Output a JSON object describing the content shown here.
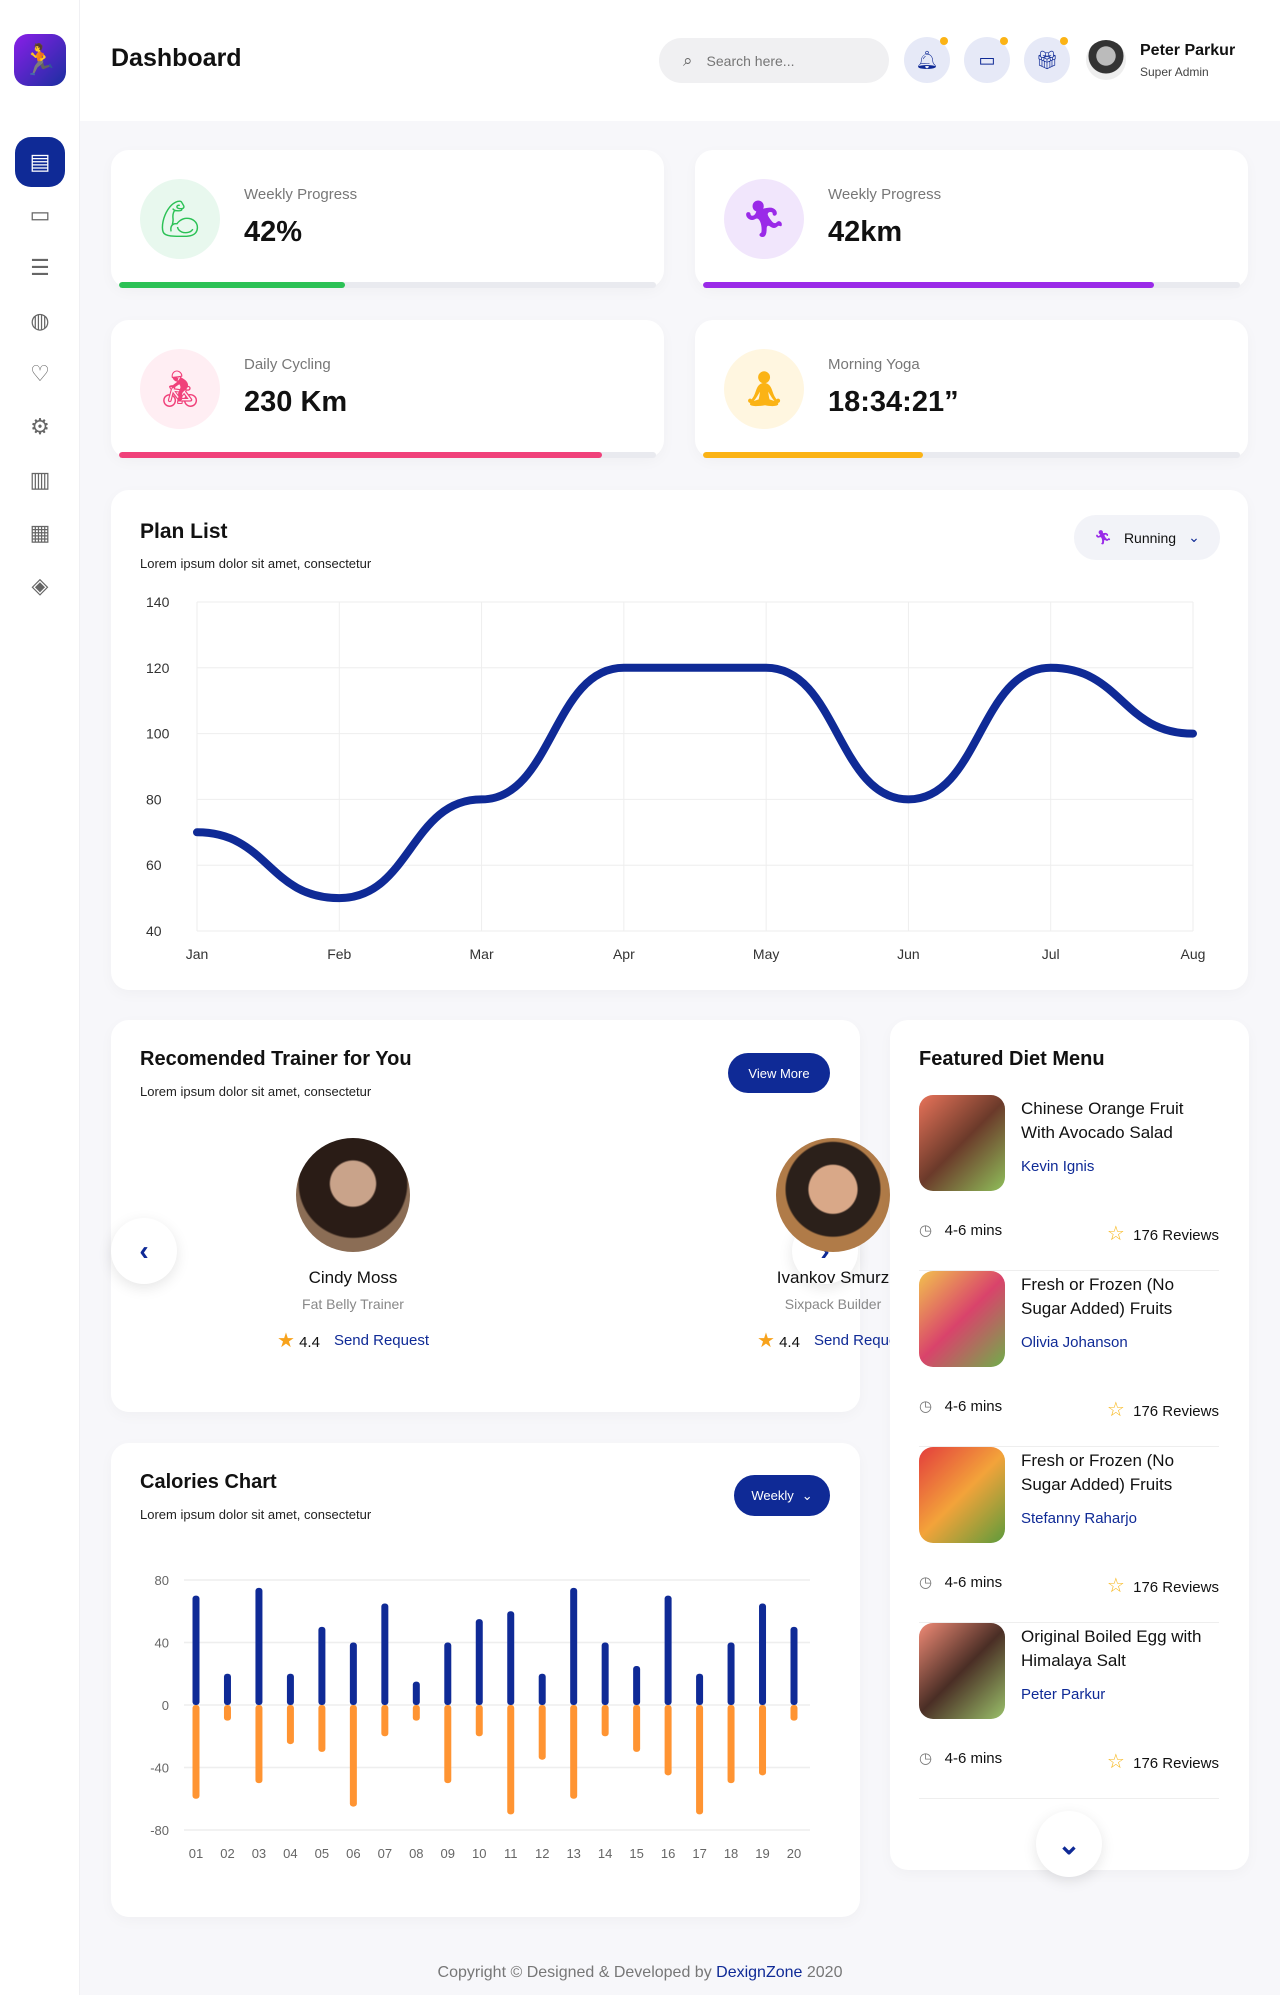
{
  "header": {
    "title": "Dashboard",
    "search_placeholder": "Search here...",
    "user_name": "Peter Parkur",
    "user_role": "Super Admin"
  },
  "sidebar": {
    "items": [
      "dashboard-icon",
      "monitor-icon",
      "sliders-icon",
      "globe-icon",
      "heart-icon",
      "settings-icon",
      "report-icon",
      "finance-icon",
      "layers-icon"
    ]
  },
  "stats": [
    {
      "label": "Weekly Progress",
      "value": "42%",
      "progress": 0.42,
      "color": "#2bc155",
      "bg": "#e8f8ee",
      "icon": "muscle-icon"
    },
    {
      "label": "Weekly Progress",
      "value": "42km",
      "progress": 0.84,
      "color": "#9a2ae8",
      "bg": "#f1e6fc",
      "icon": "running-icon"
    },
    {
      "label": "Daily Cycling",
      "value": "230 Km",
      "progress": 0.9,
      "color": "#f0417a",
      "bg": "#ffeef3",
      "icon": "cycling-icon"
    },
    {
      "label": "Morning Yoga",
      "value": "18:34:21”",
      "progress": 0.41,
      "color": "#fbb315",
      "bg": "#fff6e0",
      "icon": "yoga-icon"
    }
  ],
  "plan": {
    "title": "Plan List",
    "subtitle": "Lorem ipsum dolor sit amet, consectetur",
    "filter": "Running"
  },
  "trainers": {
    "title": "Recomended Trainer for You",
    "subtitle": "Lorem ipsum dolor sit amet, consectetur",
    "view_more": "View More",
    "items": [
      {
        "name": "Cindy Moss",
        "role": "Fat Belly Trainer",
        "rating": "4.4",
        "action": "Send Request"
      },
      {
        "name": "Ivankov Smurz",
        "role": "Sixpack Builder",
        "rating": "4.4",
        "action": "Send Request"
      }
    ]
  },
  "calories": {
    "title": "Calories Chart",
    "subtitle": "Lorem ipsum dolor sit amet, consectetur",
    "filter": "Weekly"
  },
  "diet": {
    "title": "Featured Diet Menu",
    "items": [
      {
        "title": "Chinese Orange Fruit With Avocado Salad",
        "author": "Kevin Ignis",
        "time": "4-6 mins",
        "reviews": "176 Reviews"
      },
      {
        "title": "Fresh or Frozen (No Sugar Added) Fruits",
        "author": "Olivia Johanson",
        "time": "4-6 mins",
        "reviews": "176 Reviews"
      },
      {
        "title": "Fresh or Frozen (No Sugar Added) Fruits",
        "author": "Stefanny Raharjo",
        "time": "4-6 mins",
        "reviews": "176 Reviews"
      },
      {
        "title": "Original Boiled Egg with Himalaya Salt",
        "author": "Peter Parkur",
        "time": "4-6 mins",
        "reviews": "176 Reviews"
      }
    ]
  },
  "footer": {
    "text": "Copyright © Designed & Developed by ",
    "brand": "DexignZone",
    "year": " 2020"
  },
  "chart_data": [
    {
      "type": "line",
      "categories": [
        "Jan",
        "Feb",
        "Mar",
        "Apr",
        "May",
        "Jun",
        "Jul",
        "Aug"
      ],
      "values": [
        70,
        50,
        80,
        120,
        120,
        80,
        120,
        100
      ],
      "ylim": [
        40,
        140
      ],
      "yticks": [
        140,
        120,
        100,
        80,
        60,
        40
      ],
      "color": "#0f2a96",
      "grid": true
    },
    {
      "type": "bar",
      "categories": [
        "01",
        "02",
        "03",
        "04",
        "05",
        "06",
        "07",
        "08",
        "09",
        "10",
        "11",
        "12",
        "13",
        "14",
        "15",
        "16",
        "17",
        "18",
        "19",
        "20"
      ],
      "series": [
        {
          "values": [
            70,
            20,
            75,
            20,
            50,
            40,
            65,
            15,
            40,
            55,
            60,
            20,
            75,
            40,
            25,
            70,
            20,
            40,
            65,
            50
          ],
          "color": "#0f2a96"
        },
        {
          "values": [
            -60,
            -10,
            -50,
            -25,
            -30,
            -65,
            -20,
            -10,
            -50,
            -20,
            -70,
            -35,
            -60,
            -20,
            -30,
            -45,
            -70,
            -50,
            -45,
            -10
          ],
          "color": "#ff9432"
        }
      ],
      "ylim": [
        -80,
        80
      ],
      "yticks": [
        80,
        40,
        0,
        -40,
        -80
      ],
      "grid": true
    }
  ]
}
